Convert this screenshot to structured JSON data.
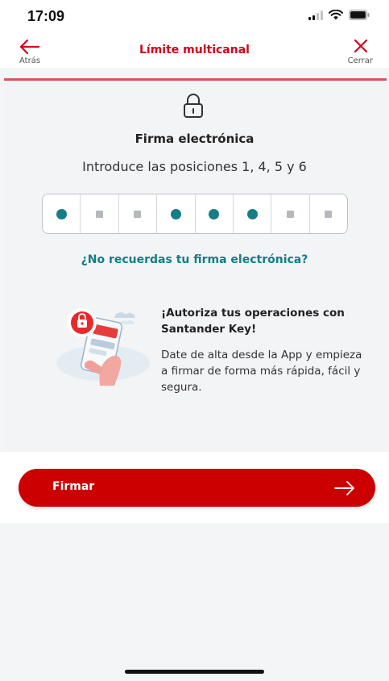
{
  "status_bar": {
    "time": "17:09"
  },
  "nav": {
    "back_label": "Atrás",
    "title": "Límite multicanal",
    "close_label": "Cerrar"
  },
  "signature": {
    "title": "Firma electrónica",
    "instruction": "Introduce las posiciones  1,  4,  5  y 6",
    "positions": [
      {
        "state": "active"
      },
      {
        "state": "inactive"
      },
      {
        "state": "inactive"
      },
      {
        "state": "active"
      },
      {
        "state": "active"
      },
      {
        "state": "active"
      },
      {
        "state": "inactive"
      },
      {
        "state": "inactive"
      }
    ],
    "forgot_link": "¿No recuerdas tu firma electrónica?"
  },
  "promo": {
    "title": "¡Autoriza tus operaciones con Santander Key!",
    "body": "Date de alta desde la App y empieza a firmar de forma más rápida, fácil y segura."
  },
  "action": {
    "submit_label": "Firmar"
  },
  "colors": {
    "brand_red": "#cc0000",
    "teal": "#137e84",
    "background": "#f4f5f7"
  }
}
